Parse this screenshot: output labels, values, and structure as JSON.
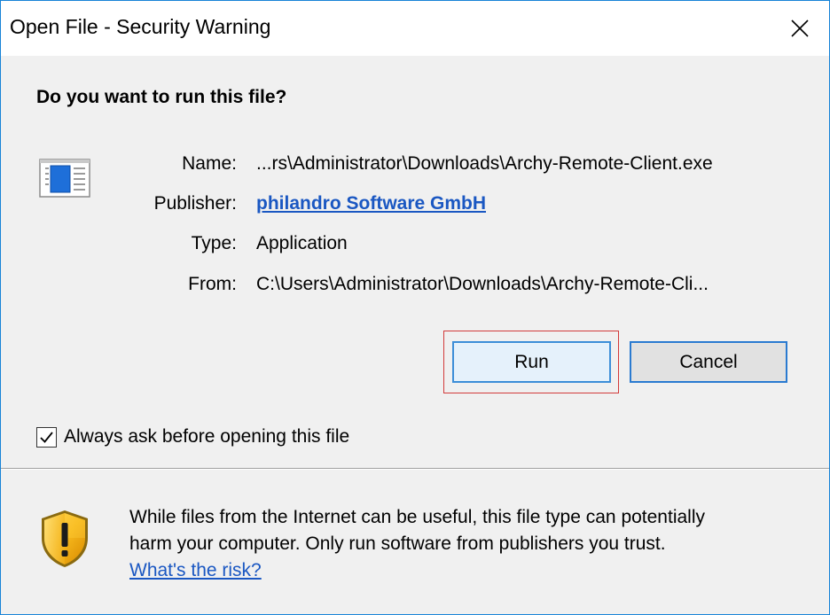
{
  "window": {
    "title": "Open File - Security Warning",
    "close_label": "Close",
    "accent_color": "#1883d7"
  },
  "question": "Do you want to run this file?",
  "file_icon": "application-file-icon",
  "details": {
    "name_label": "Name:",
    "name_value": "...rs\\Administrator\\Downloads\\Archy-Remote-Client.exe",
    "publisher_label": "Publisher:",
    "publisher_value": "philandro Software GmbH",
    "type_label": "Type:",
    "type_value": "Application",
    "from_label": "From:",
    "from_value": "C:\\Users\\Administrator\\Downloads\\Archy-Remote-Cli..."
  },
  "buttons": {
    "run_label": "Run",
    "cancel_label": "Cancel"
  },
  "checkbox": {
    "label": "Always ask before opening this file",
    "checked": true
  },
  "warning": {
    "icon": "shield-warning-icon",
    "line1": "While files from the Internet can be useful, this file type can potentially",
    "line2": "harm your computer. Only run software from publishers you trust.",
    "risk_link": "What's the risk?"
  }
}
